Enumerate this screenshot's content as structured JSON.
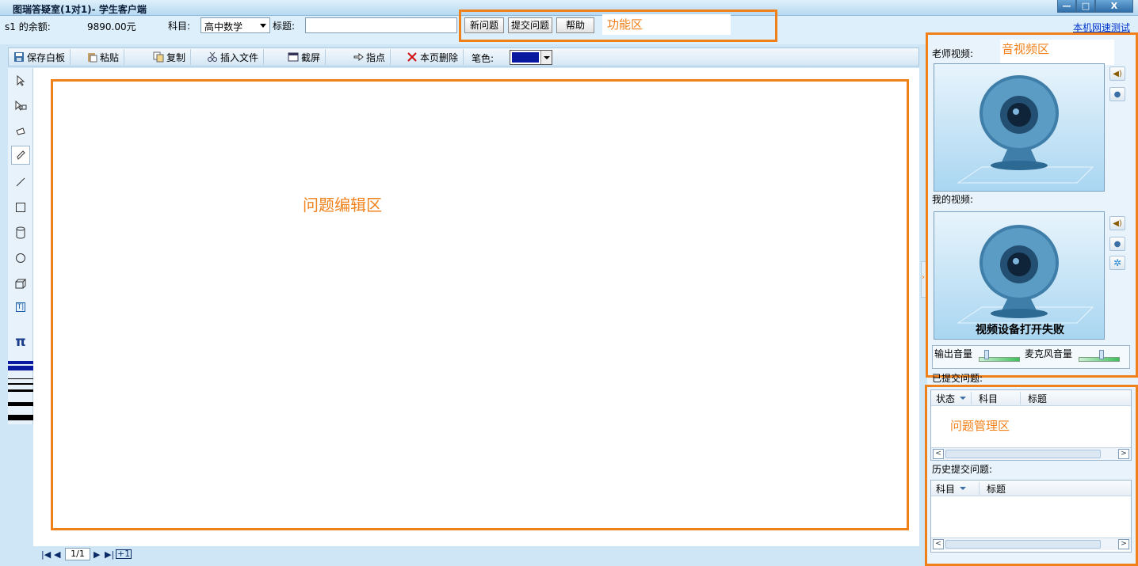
{
  "window": {
    "title": "图瑞答疑室(1对1)- 学生客户端",
    "controls": [
      "—",
      "□",
      "X"
    ]
  },
  "info": {
    "user_balance_label": "s1 的余额:",
    "balance": "9890.00元",
    "subject_label": "科目:",
    "subject_value": "高中数学",
    "title_label": "标题:",
    "title_value": ""
  },
  "function_buttons": {
    "new": "新问题",
    "submit": "提交问题",
    "help": "帮助"
  },
  "net_test_link": "本机网速测试",
  "annotations": {
    "function_area": "功能区",
    "av_area": "音视频区",
    "editor_area": "问题编辑区",
    "manage_area": "问题管理区"
  },
  "toolbar": {
    "save": "保存白板",
    "paste": "粘贴",
    "copy": "复制",
    "insert_file": "插入文件",
    "screenshot": "截屏",
    "point": "指点",
    "delete_page": "本页删除",
    "pen_color_label": "笔色:",
    "pen_color": "#0a1aa0"
  },
  "palette": {
    "pi_symbol": "π",
    "text_tool": "T|"
  },
  "pager": {
    "page": "1/1"
  },
  "video": {
    "teacher_label": "老师视频:",
    "mine_label": "我的视频:",
    "mine_error": "视频设备打开失败",
    "output_volume": "输出音量",
    "output_volume_level": 0.2,
    "mic_volume": "麦克风音量",
    "mic_volume_level": 0.55
  },
  "questions": {
    "submitted_label": "已提交问题:",
    "cols": [
      "状态",
      "科目",
      "标题"
    ],
    "history_label": "历史提交问题:",
    "history_cols": [
      "科目",
      "标题"
    ]
  }
}
